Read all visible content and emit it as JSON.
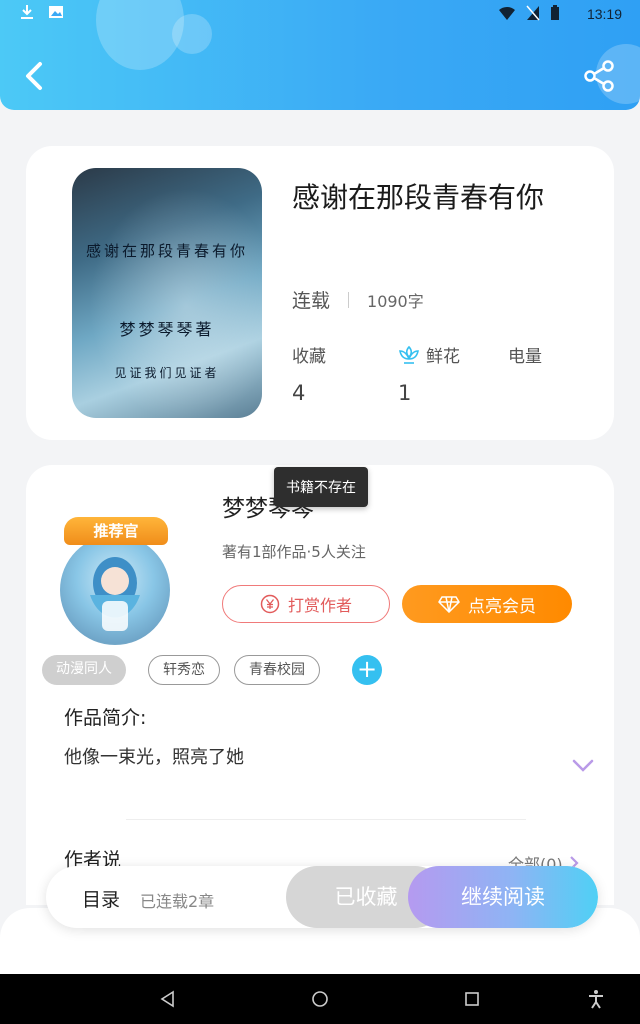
{
  "status_bar": {
    "time": "13:19"
  },
  "header": {
    "back_icon": "chevron-left-icon",
    "share_icon": "share-icon"
  },
  "book": {
    "title": "感谢在那段青春有你",
    "cover_texts": [
      "感谢在那段青春有你",
      "梦梦琴琴著",
      "见证我们见证者"
    ],
    "status": "连载",
    "word_count": "1090字",
    "stats": [
      {
        "label": "收藏",
        "value": "4"
      },
      {
        "label": "鲜花",
        "value": "1"
      },
      {
        "label": "电量",
        "value": ""
      }
    ]
  },
  "author": {
    "badge": "推荐官",
    "name": "梦梦琴琴",
    "tooltip": "书籍不存在",
    "stats": "著有1部作品·5人关注",
    "tip_button": "打赏作者",
    "vip_button": "点亮会员"
  },
  "tags": [
    "动漫同人",
    "轩秀恋",
    "青春校园"
  ],
  "intro": {
    "heading": "作品简介:",
    "text": "他像一束光，照亮了她"
  },
  "author_says": {
    "heading": "作者说",
    "all_link": "全部(0)"
  },
  "bottom_bar": {
    "toc": "目录",
    "chapters": "已连载2章",
    "favorite": "已收藏",
    "continue": "继续阅读"
  },
  "colors": {
    "accent": "#35c0f0",
    "vip": "#ff8a00",
    "tip": "#e25b5b"
  }
}
